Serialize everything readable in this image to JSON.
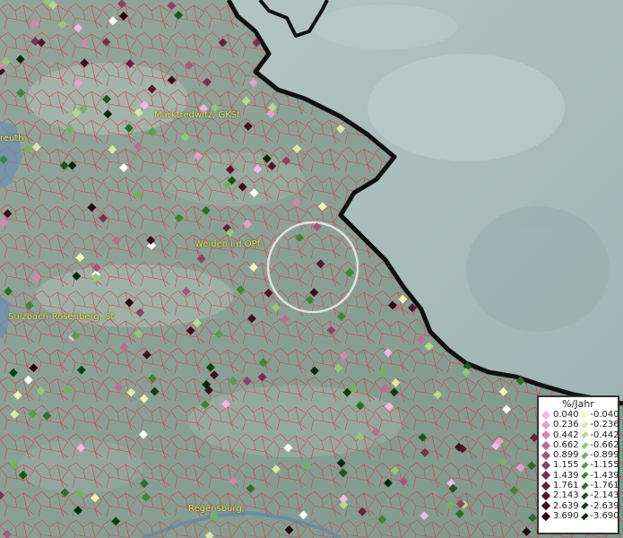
{
  "places": [
    {
      "name": "Marktredwitz, GKSt",
      "id": "marktredwitz"
    },
    {
      "name": "reuth",
      "id": "reuth"
    },
    {
      "name": "Weiden i.d.OPf.",
      "id": "weiden"
    },
    {
      "name": "Sulzbach-Rosenberg, St",
      "id": "sulzbach"
    },
    {
      "name": "Regensburg",
      "id": "regensburg"
    }
  ],
  "legend": {
    "title": "%/Jahr",
    "positive": [
      {
        "label": "0.040",
        "color": "#f4b8e6"
      },
      {
        "label": "0.236",
        "color": "#e8a0c8"
      },
      {
        "label": "0.442",
        "color": "#d487ae"
      },
      {
        "label": "0.662",
        "color": "#bf6b93"
      },
      {
        "label": "0.899",
        "color": "#a7557b"
      },
      {
        "label": "1.155",
        "color": "#8f4064"
      },
      {
        "label": "1.439",
        "color": "#7a2e4f"
      },
      {
        "label": "1.761",
        "color": "#65213d"
      },
      {
        "label": "2.143",
        "color": "#52162e"
      },
      {
        "label": "2.639",
        "color": "#3e0d20"
      },
      {
        "label": "3.690",
        "color": "#260611"
      }
    ],
    "negative": [
      {
        "label": "-0.040",
        "color": "#f0f5b8"
      },
      {
        "label": "-0.236",
        "color": "#d6eba6"
      },
      {
        "label": "-0.442",
        "color": "#b6db8e"
      },
      {
        "label": "-0.662",
        "color": "#94c776"
      },
      {
        "label": "-0.899",
        "color": "#74b35e"
      },
      {
        "label": "-1.155",
        "color": "#569e4a"
      },
      {
        "label": "-1.439",
        "color": "#3d8638"
      },
      {
        "label": "-1.761",
        "color": "#296e2a"
      },
      {
        "label": "-2.143",
        "color": "#19571e"
      },
      {
        "label": "-2.639",
        "color": "#0d4013"
      },
      {
        "label": "-3.690",
        "color": "#052a0a"
      }
    ]
  }
}
